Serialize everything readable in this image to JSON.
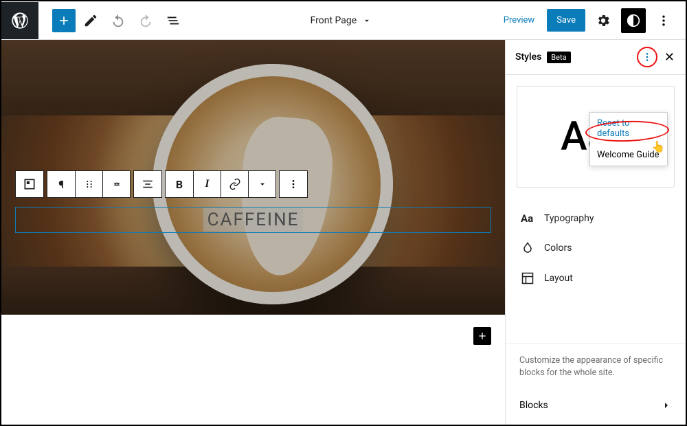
{
  "topbar": {
    "page_title": "Front Page",
    "preview": "Preview",
    "save": "Save"
  },
  "editor": {
    "heading_text": "CAFFEINE"
  },
  "sidebar": {
    "title": "Styles",
    "badge": "Beta",
    "preview_sample": "Aa",
    "menu": {
      "reset": "Reset to defaults",
      "welcome": "Welcome Guide"
    },
    "items": {
      "typography": "Typography",
      "colors": "Colors",
      "layout": "Layout"
    },
    "footer_text": "Customize the appearance of specific blocks for the whole site.",
    "blocks_label": "Blocks"
  }
}
